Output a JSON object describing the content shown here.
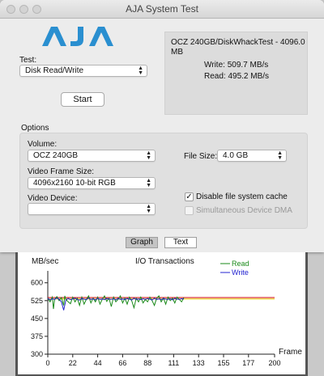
{
  "window": {
    "title": "AJA System Test"
  },
  "logo": {
    "text": "AJA",
    "color": "#2a8fd0"
  },
  "test": {
    "label": "Test:",
    "value": "Disk Read/Write",
    "start_label": "Start"
  },
  "results": {
    "device_line": "OCZ 240GB/DiskWhackTest - 4096.0",
    "device_line2": "MB",
    "write": "Write:  509.7 MB/s",
    "read": "Read:  495.2 MB/s"
  },
  "options": {
    "heading": "Options",
    "volume_label": "Volume:",
    "volume_value": "OCZ 240GB",
    "frame_size_label": "Video Frame Size:",
    "frame_size_value": "4096x2160 10-bit RGB",
    "device_label": "Video Device:",
    "device_value": "",
    "file_size_label": "File Size:",
    "file_size_value": "4.0 GB",
    "disable_cache_label": "Disable file system cache",
    "disable_cache_checked": true,
    "simultaneous_label": "Simultaneous Device DMA",
    "simultaneous_checked": false
  },
  "tabs": [
    {
      "label": "Graph",
      "active": true
    },
    {
      "label": "Text",
      "active": false
    }
  ],
  "chart_data": {
    "type": "line",
    "title": "I/O Transactions",
    "ylabel": "MB/sec",
    "xlabel": "Frame",
    "ylim": [
      300,
      650
    ],
    "xlim": [
      0,
      200
    ],
    "yticks": [
      300,
      375,
      450,
      525,
      600
    ],
    "xticks": [
      0,
      22,
      44,
      66,
      88,
      111,
      133,
      155,
      177,
      200
    ],
    "reference_lines": [
      {
        "y": 538,
        "color": "#d00000"
      },
      {
        "y": 532,
        "color": "#e6c800"
      }
    ],
    "series": [
      {
        "name": "Read",
        "color": "#1a8a1a",
        "x": [
          0,
          2,
          4,
          5,
          6,
          8,
          10,
          12,
          14,
          15,
          16,
          18,
          20,
          22,
          24,
          26,
          28,
          30,
          32,
          34,
          36,
          38,
          40,
          42,
          44,
          46,
          48,
          50,
          52,
          54,
          56,
          58,
          60,
          62,
          64,
          66,
          68,
          70,
          72,
          74,
          76,
          78,
          80,
          82,
          84,
          86,
          88,
          90,
          92,
          94,
          96,
          98,
          100,
          102,
          104,
          106,
          108,
          110,
          112,
          114,
          116,
          118,
          120
        ],
        "y": [
          535,
          520,
          540,
          490,
          530,
          542,
          525,
          538,
          505,
          545,
          530,
          520,
          512,
          540,
          520,
          535,
          505,
          540,
          510,
          530,
          545,
          515,
          535,
          520,
          540,
          510,
          530,
          545,
          522,
          535,
          500,
          540,
          520,
          530,
          545,
          515,
          535,
          510,
          540,
          525,
          495,
          535,
          520,
          540,
          515,
          530,
          520,
          540,
          525,
          505,
          535,
          545,
          520,
          535,
          510,
          540,
          525,
          535,
          515,
          540,
          530,
          520,
          538
        ]
      },
      {
        "name": "Write",
        "color": "#2323d0",
        "x": [
          0,
          2,
          4,
          6,
          8,
          10,
          12,
          14,
          16,
          18,
          20,
          22,
          24,
          26,
          28,
          30,
          32,
          34,
          36,
          38,
          40,
          42,
          44,
          46,
          48,
          50,
          52,
          54,
          56,
          58,
          60,
          62,
          64,
          66,
          68,
          70,
          72,
          74,
          76,
          78,
          80,
          82,
          84,
          86,
          88,
          90,
          92,
          94,
          96,
          98,
          100,
          102,
          104,
          106,
          108,
          110,
          112,
          114,
          116,
          118,
          120
        ],
        "y": [
          535,
          528,
          533,
          530,
          536,
          531,
          520,
          485,
          528,
          534,
          529,
          532,
          535,
          530,
          527,
          534,
          531,
          529,
          536,
          530,
          533,
          528,
          535,
          530,
          532,
          529,
          534,
          531,
          530,
          533,
          528,
          535,
          530,
          532,
          529,
          534,
          531,
          528,
          535,
          530,
          532,
          529,
          533,
          530,
          534,
          531,
          528,
          535,
          530,
          532,
          529,
          534,
          531,
          530,
          533,
          528,
          535,
          531,
          530,
          533,
          532
        ]
      }
    ]
  }
}
